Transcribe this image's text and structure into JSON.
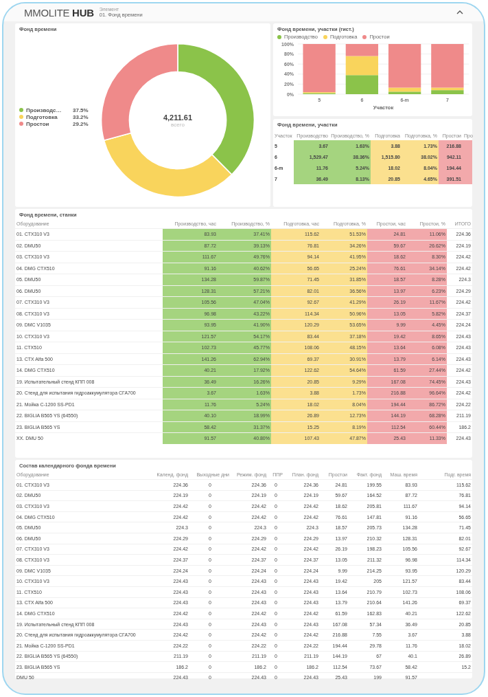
{
  "header": {
    "logo": "MMOLITE **HUB**",
    "element_label": "Элемент",
    "element_value": "01. Фонд времени"
  },
  "donut_panel": {
    "title": "Фонд времени",
    "center": {
      "value": "4,211.61",
      "label": "всего"
    },
    "chart_data": {
      "type": "donut",
      "categories": [
        "Производс…",
        "Подготовка",
        "Простои"
      ],
      "values": [
        37.5,
        33.2,
        29.2
      ],
      "colors": [
        "#8bc34a",
        "#f9d45c",
        "#ef8a8a"
      ],
      "value_labels": [
        "37.5%",
        "33.2%",
        "29.2%"
      ]
    }
  },
  "bar_panel": {
    "title": "Фонд времени, участки (гист.)",
    "chart_data": {
      "type": "bar",
      "stacked": true,
      "grid": true,
      "xlabel": "Участок",
      "categories": [
        "5",
        "6",
        "6-m",
        "7"
      ],
      "ylim": [
        0,
        100
      ],
      "yticks": [
        {
          "value": 0,
          "label": "0%"
        },
        {
          "value": 20,
          "label": "20%"
        },
        {
          "value": 40,
          "label": "40%"
        },
        {
          "value": 60,
          "label": "60%"
        },
        {
          "value": 80,
          "label": "80%"
        },
        {
          "value": 100,
          "label": "100%"
        }
      ],
      "series": [
        {
          "name": "Производство",
          "color": "#8bc34a",
          "values": [
            2,
            38,
            5,
            8
          ]
        },
        {
          "name": "Подготовка",
          "color": "#f9d45c",
          "values": [
            2,
            38,
            8,
            5
          ]
        },
        {
          "name": "Простои",
          "color": "#ef8a8a",
          "values": [
            96,
            24,
            87,
            87
          ]
        }
      ]
    }
  },
  "area_table": {
    "title": "Фонд времени, участки",
    "columns": [
      {
        "label": "Участок",
        "kind": "name"
      },
      {
        "label": "Производство",
        "kind": "prod"
      },
      {
        "label": "Производство, %",
        "kind": "prod"
      },
      {
        "label": "Подготовка",
        "kind": "prep"
      },
      {
        "label": "Подготовка, %",
        "kind": "prep"
      },
      {
        "label": "Простои",
        "kind": "idle"
      },
      {
        "label": "Про",
        "kind": "idle"
      }
    ],
    "rows": [
      [
        "5",
        "3.67",
        "1.63%",
        "3.88",
        "1.73%",
        "216.88"
      ],
      [
        "6",
        "1,529.47",
        "38.36%",
        "1,515.80",
        "38.02%",
        "942.11"
      ],
      [
        "6-m",
        "11.76",
        "5.24%",
        "18.02",
        "8.04%",
        "194.44"
      ],
      [
        "7",
        "36.49",
        "8.13%",
        "20.85",
        "4.65%",
        "391.51"
      ]
    ]
  },
  "machine_table": {
    "title": "Фонд времени, станки",
    "columns": [
      {
        "label": "Оборудование",
        "kind": "name"
      },
      {
        "label": "Производство, час",
        "kind": "prod"
      },
      {
        "label": "Производство, %",
        "kind": "prod"
      },
      {
        "label": "Подготовка, час",
        "kind": "prep"
      },
      {
        "label": "Подготовка, %",
        "kind": "prep"
      },
      {
        "label": "Простои, час",
        "kind": "idle"
      },
      {
        "label": "Простои, %",
        "kind": "idle"
      },
      {
        "label": "ИТОГО",
        "kind": "total"
      }
    ],
    "rows": [
      [
        "01. CTX310 V3",
        "83.93",
        "37.41%",
        "115.62",
        "51.53%",
        "24.81",
        "11.06%",
        "224.36"
      ],
      [
        "02. DMU50",
        "87.72",
        "39.13%",
        "76.81",
        "34.26%",
        "59.67",
        "26.62%",
        "224.19"
      ],
      [
        "03. CTX310 V3",
        "111.67",
        "49.76%",
        "94.14",
        "41.95%",
        "18.62",
        "8.30%",
        "224.42"
      ],
      [
        "04. DMG CTX510",
        "91.16",
        "40.62%",
        "56.65",
        "25.24%",
        "76.61",
        "34.14%",
        "224.42"
      ],
      [
        "05. DMU50",
        "134.28",
        "59.87%",
        "71.45",
        "31.85%",
        "18.57",
        "8.28%",
        "224.3"
      ],
      [
        "06. DMU50",
        "128.31",
        "57.21%",
        "82.01",
        "36.56%",
        "13.97",
        "6.23%",
        "224.29"
      ],
      [
        "07. CTX310 V3",
        "105.56",
        "47.04%",
        "92.67",
        "41.29%",
        "26.19",
        "11.67%",
        "224.42"
      ],
      [
        "08. CTX310 V3",
        "96.98",
        "43.22%",
        "114.34",
        "50.96%",
        "13.05",
        "5.82%",
        "224.37"
      ],
      [
        "09. DMC V1035",
        "93.95",
        "41.90%",
        "120.29",
        "53.65%",
        "9.99",
        "4.45%",
        "224.24"
      ],
      [
        "10. CTX310 V3",
        "121.57",
        "54.17%",
        "83.44",
        "37.18%",
        "19.42",
        "8.65%",
        "224.43"
      ],
      [
        "11. CTX510",
        "102.73",
        "45.77%",
        "108.06",
        "48.15%",
        "13.64",
        "6.08%",
        "224.43"
      ],
      [
        "13. CTX Alfa 500",
        "141.26",
        "62.94%",
        "69.37",
        "30.91%",
        "13.79",
        "6.14%",
        "224.43"
      ],
      [
        "14. DMG CTX510",
        "40.21",
        "17.92%",
        "122.62",
        "54.64%",
        "61.59",
        "27.44%",
        "224.42"
      ],
      [
        "19. Испытательный стенд КПП 008",
        "36.49",
        "16.26%",
        "20.85",
        "9.29%",
        "167.08",
        "74.45%",
        "224.43"
      ],
      [
        "20. Стенд для испытания гидроаккумулятора СГА700",
        "3.67",
        "1.63%",
        "3.88",
        "1.73%",
        "216.88",
        "96.64%",
        "224.42"
      ],
      [
        "21. Мойка C-1200 SS-PD1",
        "11.76",
        "5.24%",
        "18.02",
        "8.04%",
        "194.44",
        "86.72%",
        "224.22"
      ],
      [
        "22. BIGLIA B565 YS (64550)",
        "40.10",
        "18.99%",
        "26.89",
        "12.73%",
        "144.19",
        "68.28%",
        "211.19"
      ],
      [
        "23. BIGLIA B565 YS",
        "58.42",
        "31.37%",
        "15.25",
        "8.19%",
        "112.54",
        "60.44%",
        "186.2"
      ],
      [
        "XX. DMU 50",
        "91.57",
        "40.80%",
        "107.43",
        "47.87%",
        "25.43",
        "11.33%",
        "224.43"
      ]
    ]
  },
  "calendar_table": {
    "title": "Состав календарного фонда времени",
    "columns": [
      "Оборудование",
      "Календ. фонд",
      "Выходные дни",
      "Режим. фонд",
      "ППР",
      "План. фонд",
      "Простои",
      "Факт. фонд",
      "Маш. время",
      "Подг. время"
    ],
    "rows": [
      [
        "01. CTX310 V3",
        "224.36",
        "0",
        "224.36",
        "0",
        "224.36",
        "24.81",
        "199.55",
        "83.93",
        "115.62"
      ],
      [
        "02. DMU50",
        "224.19",
        "0",
        "224.19",
        "0",
        "224.19",
        "59.67",
        "164.52",
        "87.72",
        "76.81"
      ],
      [
        "03. CTX310 V3",
        "224.42",
        "0",
        "224.42",
        "0",
        "224.42",
        "18.62",
        "205.81",
        "111.67",
        "94.14"
      ],
      [
        "04. DMG CTX510",
        "224.42",
        "0",
        "224.42",
        "0",
        "224.42",
        "76.61",
        "147.81",
        "91.16",
        "56.65"
      ],
      [
        "05. DMU50",
        "224.3",
        "0",
        "224.3",
        "0",
        "224.3",
        "18.57",
        "205.73",
        "134.28",
        "71.45"
      ],
      [
        "06. DMU50",
        "224.29",
        "0",
        "224.29",
        "0",
        "224.29",
        "13.97",
        "210.32",
        "128.31",
        "82.01"
      ],
      [
        "07. CTX310 V3",
        "224.42",
        "0",
        "224.42",
        "0",
        "224.42",
        "26.19",
        "198.23",
        "105.56",
        "92.67"
      ],
      [
        "08. CTX310 V3",
        "224.37",
        "0",
        "224.37",
        "0",
        "224.37",
        "13.05",
        "211.32",
        "96.98",
        "114.34"
      ],
      [
        "09. DMC V1035",
        "224.24",
        "0",
        "224.24",
        "0",
        "224.24",
        "9.99",
        "214.25",
        "93.95",
        "120.29"
      ],
      [
        "10. CTX310 V3",
        "224.43",
        "0",
        "224.43",
        "0",
        "224.43",
        "19.42",
        "205",
        "121.57",
        "83.44"
      ],
      [
        "11. CTX510",
        "224.43",
        "0",
        "224.43",
        "0",
        "224.43",
        "13.64",
        "210.79",
        "102.73",
        "108.06"
      ],
      [
        "13. CTX Alfa 500",
        "224.43",
        "0",
        "224.43",
        "0",
        "224.43",
        "13.79",
        "210.64",
        "141.26",
        "69.37"
      ],
      [
        "14. DMG CTX510",
        "224.42",
        "0",
        "224.42",
        "0",
        "224.42",
        "61.59",
        "162.83",
        "40.21",
        "122.62"
      ],
      [
        "19. Испытательный стенд КПП 008",
        "224.43",
        "0",
        "224.43",
        "0",
        "224.43",
        "167.08",
        "57.34",
        "36.49",
        "20.85"
      ],
      [
        "20. Стенд для испытания гидроаккумулятора СГА700",
        "224.42",
        "0",
        "224.42",
        "0",
        "224.42",
        "216.88",
        "7.55",
        "3.67",
        "3.88"
      ],
      [
        "21. Мойка C-1200 SS-PD1",
        "224.22",
        "0",
        "224.22",
        "0",
        "224.22",
        "194.44",
        "29.78",
        "11.76",
        "18.02"
      ],
      [
        "22. BIGLIA B565 YS (64550)",
        "211.19",
        "0",
        "211.19",
        "0",
        "211.19",
        "144.19",
        "67",
        "40.1",
        "26.89"
      ],
      [
        "23. BIGLIA B565 YS",
        "186.2",
        "0",
        "186.2",
        "0",
        "186.2",
        "112.54",
        "73.67",
        "58.42",
        "15.2"
      ],
      [
        "DMU 50",
        "224.43",
        "0",
        "224.43",
        "0",
        "224.43",
        "25.43",
        "199",
        "91.57"
      ]
    ]
  }
}
